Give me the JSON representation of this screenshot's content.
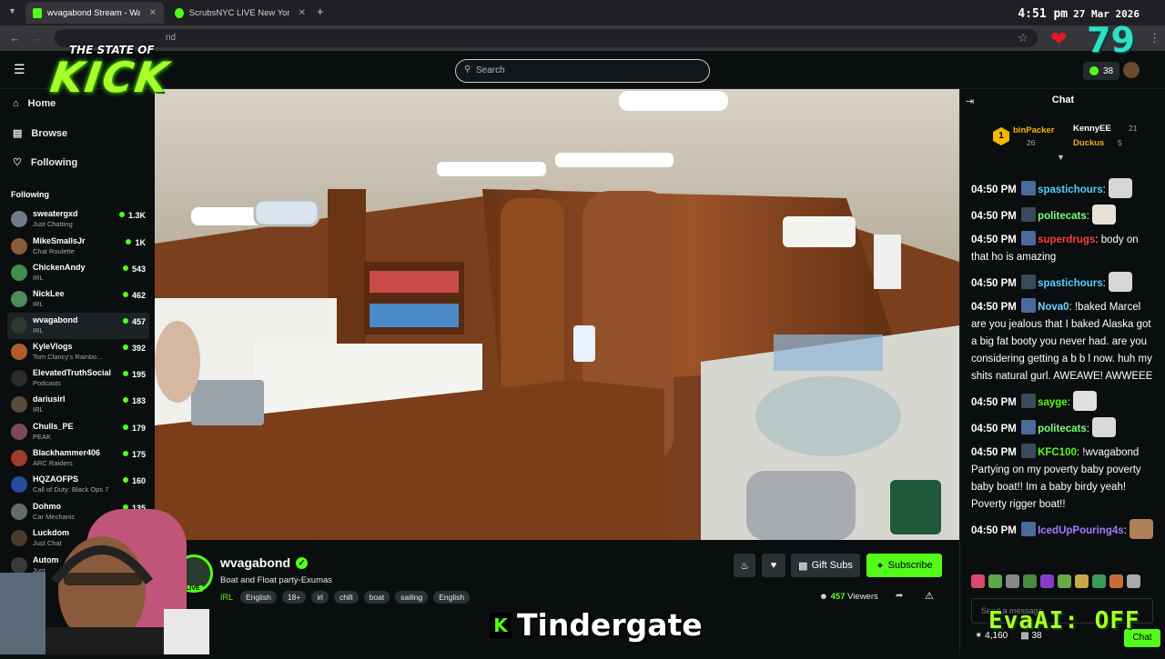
{
  "browser": {
    "tabs": [
      {
        "label": "wvagabond Stream - Watch",
        "active": true
      },
      {
        "label": "ScrubsNYC LIVE New York (",
        "active": false
      }
    ],
    "new_tab": "+",
    "address_partial": "nd",
    "clock_time": "4:51 pm",
    "clock_date": "27 Mar 2026"
  },
  "overlay": {
    "logo_top": "THE STATE OF",
    "logo_main": "KICK",
    "counter": "79",
    "caption": "Tindergate",
    "caption_icon": "K",
    "evaai": "EvaAI: OFF"
  },
  "header": {
    "search_placeholder": "Search",
    "kicks_count": "38"
  },
  "sidebar": {
    "nav": [
      {
        "label": "Home",
        "icon": "home-icon"
      },
      {
        "label": "Browse",
        "icon": "browse-icon"
      },
      {
        "label": "Following",
        "icon": "heart-icon"
      }
    ],
    "following_heading": "Following",
    "channels": [
      {
        "name": "sweatergxd",
        "category": "Just Chatting",
        "viewers": "1.3K",
        "color": "#6e7b8b"
      },
      {
        "name": "MikeSmallsJr",
        "category": "Chat Roulette",
        "viewers": "1K",
        "color": "#8a5a3c"
      },
      {
        "name": "ChickenAndy",
        "category": "IRL",
        "viewers": "543",
        "color": "#3d8f4a"
      },
      {
        "name": "NickLee",
        "category": "IRL",
        "viewers": "462",
        "color": "#4f8a5d"
      },
      {
        "name": "wvagabond",
        "category": "IRL",
        "viewers": "457",
        "color": "#2a3a2c"
      },
      {
        "name": "KyleVlogs",
        "category": "Tom Clancy's Rainbo...",
        "viewers": "392",
        "color": "#b45a2d"
      },
      {
        "name": "ElevatedTruthSocial",
        "category": "Podcasts",
        "viewers": "195",
        "color": "#2b2b2b"
      },
      {
        "name": "dariusirl",
        "category": "IRL",
        "viewers": "183",
        "color": "#5a4a3a"
      },
      {
        "name": "Chulls_PE",
        "category": "PEAK",
        "viewers": "179",
        "color": "#7a4a5a"
      },
      {
        "name": "Blackhammer406",
        "category": "ARC Raiders",
        "viewers": "175",
        "color": "#a03a2a"
      },
      {
        "name": "HQZAOFPS",
        "category": "Call of Duty: Black Ops 7",
        "viewers": "160",
        "color": "#2a4a9a"
      },
      {
        "name": "Dohmo",
        "category": "Car Mechanic",
        "viewers": "135",
        "color": "#6a6a6a"
      },
      {
        "name": "Luckdom",
        "category": "Just Chat",
        "viewers": "",
        "color": "#4a3a2a"
      },
      {
        "name": "Autom",
        "category": "Just",
        "viewers": "",
        "color": "#3a3a3a"
      }
    ]
  },
  "stream": {
    "name": "wvagabond",
    "live_badge": "LIVE",
    "title": "Boat and Float party-Exumas",
    "category": "IRL",
    "tags": [
      "English",
      "18+",
      "irl",
      "chill",
      "boat",
      "sailing",
      "English"
    ],
    "viewers_count": "457",
    "viewers_label": "Viewers",
    "gift_subs_label": "Gift Subs",
    "subscribe_label": "Subscribe"
  },
  "chat": {
    "heading": "Chat",
    "leaderboard": [
      {
        "rank": "1",
        "name": "binPacker",
        "count": "26"
      },
      {
        "name": "KennyEE",
        "count": "21"
      },
      {
        "name": "Duckus",
        "count": "5"
      }
    ],
    "messages": [
      {
        "time": "04:50 PM",
        "user": "spastichours",
        "color": "#4fd1ff",
        "text": ""
      },
      {
        "time": "04:50 PM",
        "user": "politecats",
        "color": "#7cff7c",
        "text": ""
      },
      {
        "time": "04:50 PM",
        "user": "superdrugs",
        "color": "#ff3d3d",
        "text": "body on that ho is amazing"
      },
      {
        "time": "04:50 PM",
        "user": "spastichours",
        "color": "#4fd1ff",
        "text": ""
      },
      {
        "time": "04:50 PM",
        "user": "Nova0",
        "color": "#6fd3ff",
        "text": "!baked Marcel are you jealous that I baked Alaska got a big fat booty you never had. are you considering getting a b b l now. huh my shits natural gurl. AWEAWE! AWWEEE"
      },
      {
        "time": "04:50 PM",
        "user": "sayge",
        "color": "#53fc18",
        "text": ""
      },
      {
        "time": "04:50 PM",
        "user": "politecats",
        "color": "#7cff7c",
        "text": ""
      },
      {
        "time": "04:50 PM",
        "user": "KFC100",
        "color": "#53fc18",
        "text": "!wvagabond Partying on my poverty baby poverty baby boat!! Im a baby birdy yeah! Poverty rigger boat!!"
      },
      {
        "time": "04:50 PM",
        "user": "IcedUpPouring4s",
        "color": "#9f7bff",
        "text": ""
      }
    ],
    "input_placeholder": "Send a message",
    "footer_points": "4,160",
    "footer_kicks": "38",
    "chat_button": "Chat"
  }
}
